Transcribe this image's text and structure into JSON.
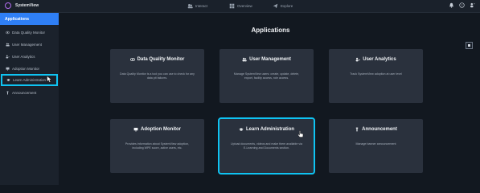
{
  "app": {
    "name": "SystemView"
  },
  "nav": {
    "interact": "Interact",
    "overview": "Overview",
    "explore": "Explore"
  },
  "sidebar": {
    "header": "Applications",
    "items": [
      {
        "label": "Data Quality Monitor",
        "icon": "eye-icon"
      },
      {
        "label": "User Management",
        "icon": "users-icon"
      },
      {
        "label": "User Analytics",
        "icon": "user-analytics-icon"
      },
      {
        "label": "Adoption Monitor",
        "icon": "monitor-icon"
      },
      {
        "label": "Learn Administration",
        "icon": "graduation-cap-icon"
      },
      {
        "label": "Announcement",
        "icon": "announcement-icon"
      }
    ]
  },
  "main": {
    "title": "Applications",
    "cards": [
      {
        "title": "Data Quality Monitor",
        "icon": "eye-icon",
        "description": "Data Quality Monitor is a tool you can use to check for any data pit failures."
      },
      {
        "title": "User Management",
        "icon": "users-icon",
        "description": "Manage SystemView users: create, update, delete, export, facility access, role access."
      },
      {
        "title": "User Analytics",
        "icon": "user-analytics-icon",
        "description": "Track SystemView adoption at user level"
      },
      {
        "title": "Adoption Monitor",
        "icon": "monitor-icon",
        "description": "Provides information about SystemView adoption, including WPE score, active users, etc."
      },
      {
        "title": "Learn Administration",
        "icon": "graduation-cap-icon",
        "description": "Upload documents, videos and make them available via E-Learning and Documents section."
      },
      {
        "title": "Announcement",
        "icon": "announcement-icon",
        "description": "Manage banner announcement"
      }
    ]
  },
  "colors": {
    "accent": "#2f7ff5",
    "highlight": "#0fc3f2",
    "background": "#121820",
    "card": "#2a313d"
  }
}
